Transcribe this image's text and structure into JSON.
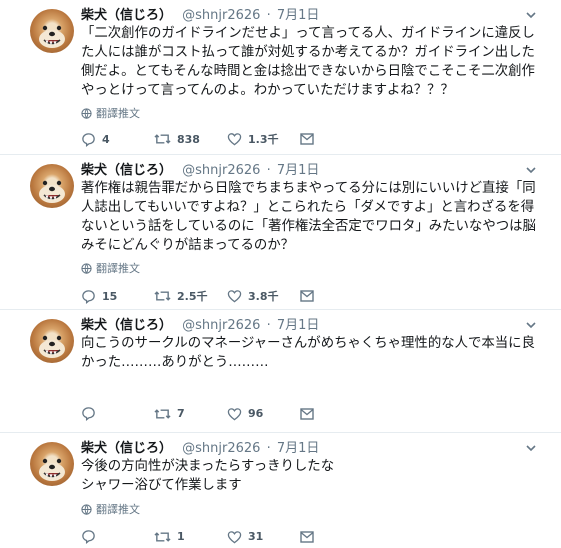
{
  "tweets": [
    {
      "name": "柴犬（信じろ）",
      "handle": "@shnjr2626",
      "date": "7月1日",
      "text": "「二次創作のガイドラインだせよ」って言ってる人、ガイドラインに違反した人には誰がコスト払って誰が対処するか考えてるか？ガイドライン出した側だよ。とてもそんな時間と金は捻出できないから日陰でこそこそ二次創作やっとけって言ってんのよ。わかっていただけますよね？？？",
      "translate": "翻譯推文",
      "replies": "4",
      "retweets": "838",
      "likes": "1.3千"
    },
    {
      "name": "柴犬（信じろ）",
      "handle": "@shnjr2626",
      "date": "7月1日",
      "text": "著作権は親告罪だから日陰でちまちまやってる分には別にいいけど直接「同人誌出してもいいですよね？」とこられたら「ダメですよ」と言わざるを得ないという話をしているのに「著作権法全否定でワロタ」みたいなやつは脳みそにどんぐりが詰まってるのか？",
      "translate": "翻譯推文",
      "replies": "15",
      "retweets": "2.5千",
      "likes": "3.8千"
    },
    {
      "name": "柴犬（信じろ）",
      "handle": "@shnjr2626",
      "date": "7月1日",
      "text": "向こうのサークルのマネージャーさんがめちゃくちゃ理性的な人で本当に良かった………ありがとう………",
      "translate": "",
      "replies": "",
      "retweets": "7",
      "likes": "96"
    },
    {
      "name": "柴犬（信じろ）",
      "handle": "@shnjr2626",
      "date": "7月1日",
      "text": "今後の方向性が決まったらすっきりしたな\nシャワー浴びて作業します",
      "translate": "翻譯推文",
      "replies": "",
      "retweets": "1",
      "likes": "31"
    }
  ],
  "icons": {
    "reply": "reply-icon",
    "retweet": "retweet-icon",
    "like": "heart-icon",
    "dm": "envelope-icon",
    "translate": "globe-icon",
    "caret": "chevron-down-icon"
  },
  "colors": {
    "text": "#14171a",
    "muted": "#657786",
    "divider": "#e6ecf0"
  }
}
